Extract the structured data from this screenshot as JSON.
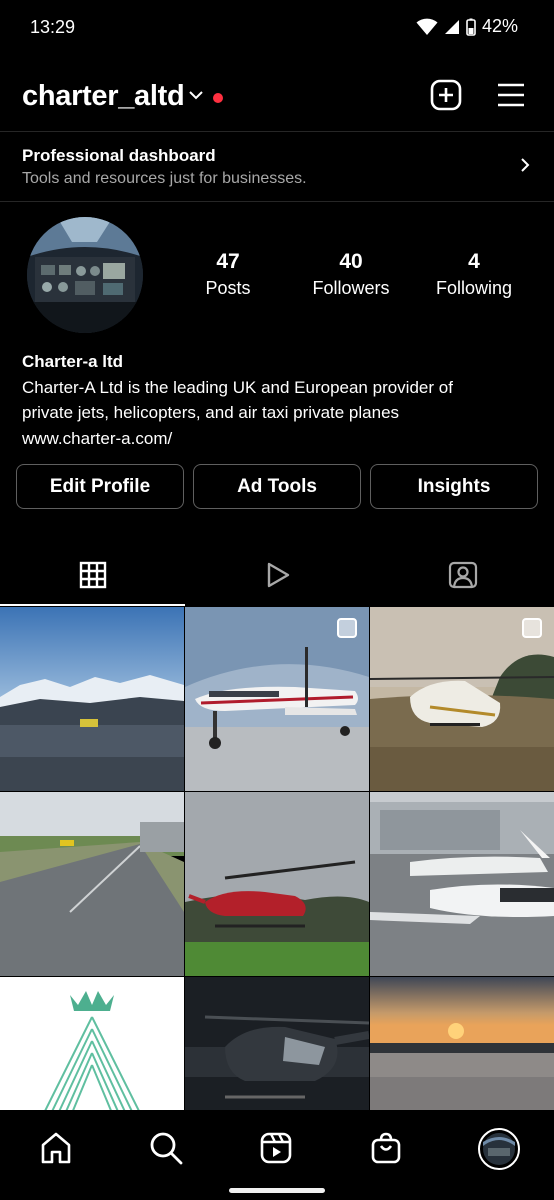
{
  "status": {
    "time": "13:29",
    "battery": "42%"
  },
  "header": {
    "username": "charter_altd"
  },
  "dashboard": {
    "title": "Professional dashboard",
    "subtitle": "Tools and resources just for businesses."
  },
  "profile": {
    "stats": [
      {
        "value": "47",
        "label": "Posts"
      },
      {
        "value": "40",
        "label": "Followers"
      },
      {
        "value": "4",
        "label": "Following"
      }
    ],
    "name": "Charter-a ltd",
    "bio_line1": "Charter-A Ltd is the leading UK and European provider of",
    "bio_line2": "private jets, helicopters, and air taxi private planes",
    "website": "www.charter-a.com/"
  },
  "buttons": {
    "edit_profile": "Edit Profile",
    "ad_tools": "Ad Tools",
    "insights": "Insights"
  },
  "tabs": [
    {
      "icon": "grid-icon",
      "active": true
    },
    {
      "icon": "reels-play-icon",
      "active": false
    },
    {
      "icon": "tagged-person-icon",
      "active": false
    }
  ],
  "posts": [
    {
      "subject": "airport-snowy-mountains",
      "multi": false
    },
    {
      "subject": "turboprop-plane-hangar",
      "multi": true
    },
    {
      "subject": "white-helicopter-field",
      "multi": true
    },
    {
      "subject": "airfield-runway",
      "multi": false
    },
    {
      "subject": "red-helicopter-grass",
      "multi": false
    },
    {
      "subject": "private-jets-apron",
      "multi": false
    },
    {
      "subject": "charter-a-logo",
      "multi": false
    },
    {
      "subject": "black-helicopter-night",
      "multi": false
    },
    {
      "subject": "sunset-field",
      "multi": false
    }
  ],
  "bottom_nav": [
    "home-icon",
    "search-icon",
    "reels-icon",
    "shop-icon",
    "profile-avatar"
  ]
}
